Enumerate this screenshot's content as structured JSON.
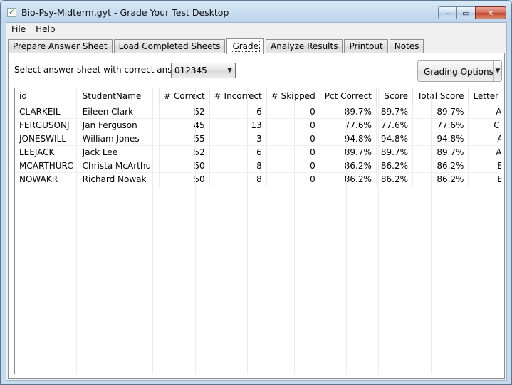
{
  "window": {
    "title": "Bio-Psy-Midterm.gyt - Grade Your Test Desktop",
    "minimize_glyph": "–",
    "maximize_glyph": "▭",
    "close_glyph": "✕"
  },
  "menu": [
    {
      "label": "File"
    },
    {
      "label": "Help"
    }
  ],
  "tabs": [
    {
      "label": "Prepare Answer Sheet",
      "active": false
    },
    {
      "label": "Load Completed Sheets",
      "active": false
    },
    {
      "label": "Grade",
      "active": true
    },
    {
      "label": "Analyze Results",
      "active": false
    },
    {
      "label": "Printout",
      "active": false
    },
    {
      "label": "Notes",
      "active": false
    }
  ],
  "grade": {
    "select_label": "Select answer sheet with correct answers:",
    "selected_sheet": "012345",
    "grading_options_label": "Grading Options",
    "columns": [
      "id",
      "StudentName",
      "# Correct",
      "# Incorrect",
      "# Skipped",
      "Pct Correct",
      "Score",
      "Total Score",
      "Letter Grade"
    ],
    "rows": [
      [
        "CLARKEIL",
        "Eileen Clark",
        "52",
        "6",
        "0",
        "89.7%",
        "89.7%",
        "89.7%",
        "A-"
      ],
      [
        "FERGUSONJ",
        "Jan Ferguson",
        "45",
        "13",
        "0",
        "77.6%",
        "77.6%",
        "77.6%",
        "C+"
      ],
      [
        "JONESWILL",
        "William Jones",
        "55",
        "3",
        "0",
        "94.8%",
        "94.8%",
        "94.8%",
        "A"
      ],
      [
        "LEEJACK",
        "Jack Lee",
        "52",
        "6",
        "0",
        "89.7%",
        "89.7%",
        "89.7%",
        "A-"
      ],
      [
        "MCARTHURC",
        "Christa McArthur",
        "50",
        "8",
        "0",
        "86.2%",
        "86.2%",
        "86.2%",
        "B"
      ],
      [
        "NOWAKR",
        "Richard Nowak",
        "50",
        "8",
        "0",
        "86.2%",
        "86.2%",
        "86.2%",
        "B"
      ]
    ]
  }
}
